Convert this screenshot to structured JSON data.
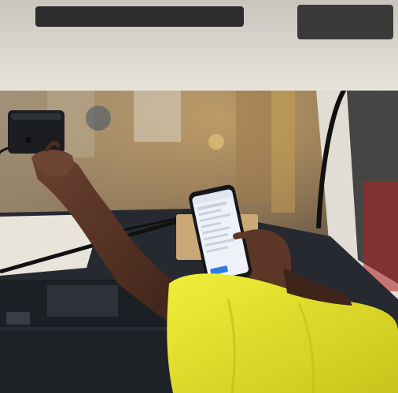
{
  "scene": {
    "description_tag": "photo",
    "subjects": [
      "worker-arm",
      "dash-camera",
      "smartphone",
      "truck-windshield"
    ]
  },
  "colors": {
    "shirt": "#e6e22a",
    "skin": "#5a3526",
    "dashboard": "#1e2126",
    "windshield_frame": "#d9d6cf",
    "camera": "#1b1d20",
    "phone_screen": "#eef2f8",
    "phone_accent": "#2f7be0",
    "background_blur": "#7a6a52"
  }
}
